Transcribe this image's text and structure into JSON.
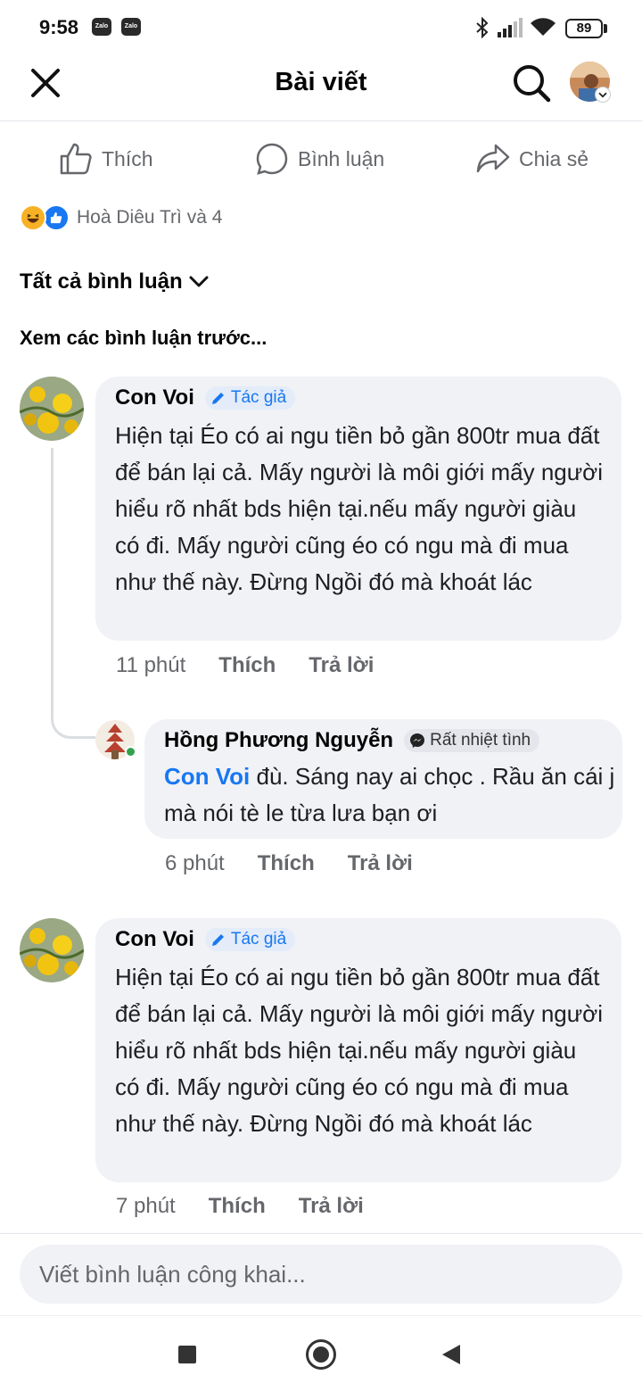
{
  "status_bar": {
    "time": "9:58",
    "notification_icons": [
      "Zalo",
      "Zalo"
    ],
    "battery": 89
  },
  "header": {
    "title": "Bài viết"
  },
  "actions": {
    "like_label": "Thích",
    "comment_label": "Bình luận",
    "share_label": "Chia sẻ"
  },
  "reactions": {
    "types": [
      "haha",
      "like"
    ],
    "summary": "Hoà Diêu Trì và 4"
  },
  "comments_filter": {
    "label": "Tất cả bình luận"
  },
  "previous_comments_label": "Xem các bình luận trước...",
  "comments": [
    {
      "author": "Con Voi",
      "badge": "Tác giả",
      "text": "Hiện tại Éo có ai ngu tiền bỏ gần 800tr mua đất để bán lại cả. Mấy người là môi giới mấy người hiểu rõ nhất bds hiện tại.nếu mấy người giàu có đi. Mấy người cũng éo có ngu mà đi mua như thế này. Đừng Ngồi đó mà khoát lác",
      "time": "11 phút",
      "like": "Thích",
      "reply": "Trả lời"
    },
    {
      "author": "Hồng Phương Nguyễn",
      "badge": "Rất nhiệt tình",
      "mention": "Con Voi",
      "text": " đù. Sáng nay ai chọc . Rầu ăn cái j mà nói tè le từa lưa bạn ơi",
      "time": "6 phút",
      "like": "Thích",
      "reply": "Trả lời"
    },
    {
      "author": "Con Voi",
      "badge": "Tác giả",
      "text": "Hiện tại Éo có ai ngu tiền bỏ gần 800tr mua đất để bán lại cả. Mấy người là môi giới mấy người hiểu rõ nhất bds hiện tại.nếu mấy người giàu có đi. Mấy người cũng éo có ngu mà đi mua như thế này. Đừng Ngồi đó mà khoát lác",
      "time": "7 phút",
      "like": "Thích",
      "reply": "Trả lời"
    }
  ],
  "composer": {
    "placeholder": "Viết bình luận công khai..."
  },
  "colors": {
    "accent": "#1877f2",
    "bubble": "#f0f2f5",
    "secondary_text": "#65676b"
  }
}
